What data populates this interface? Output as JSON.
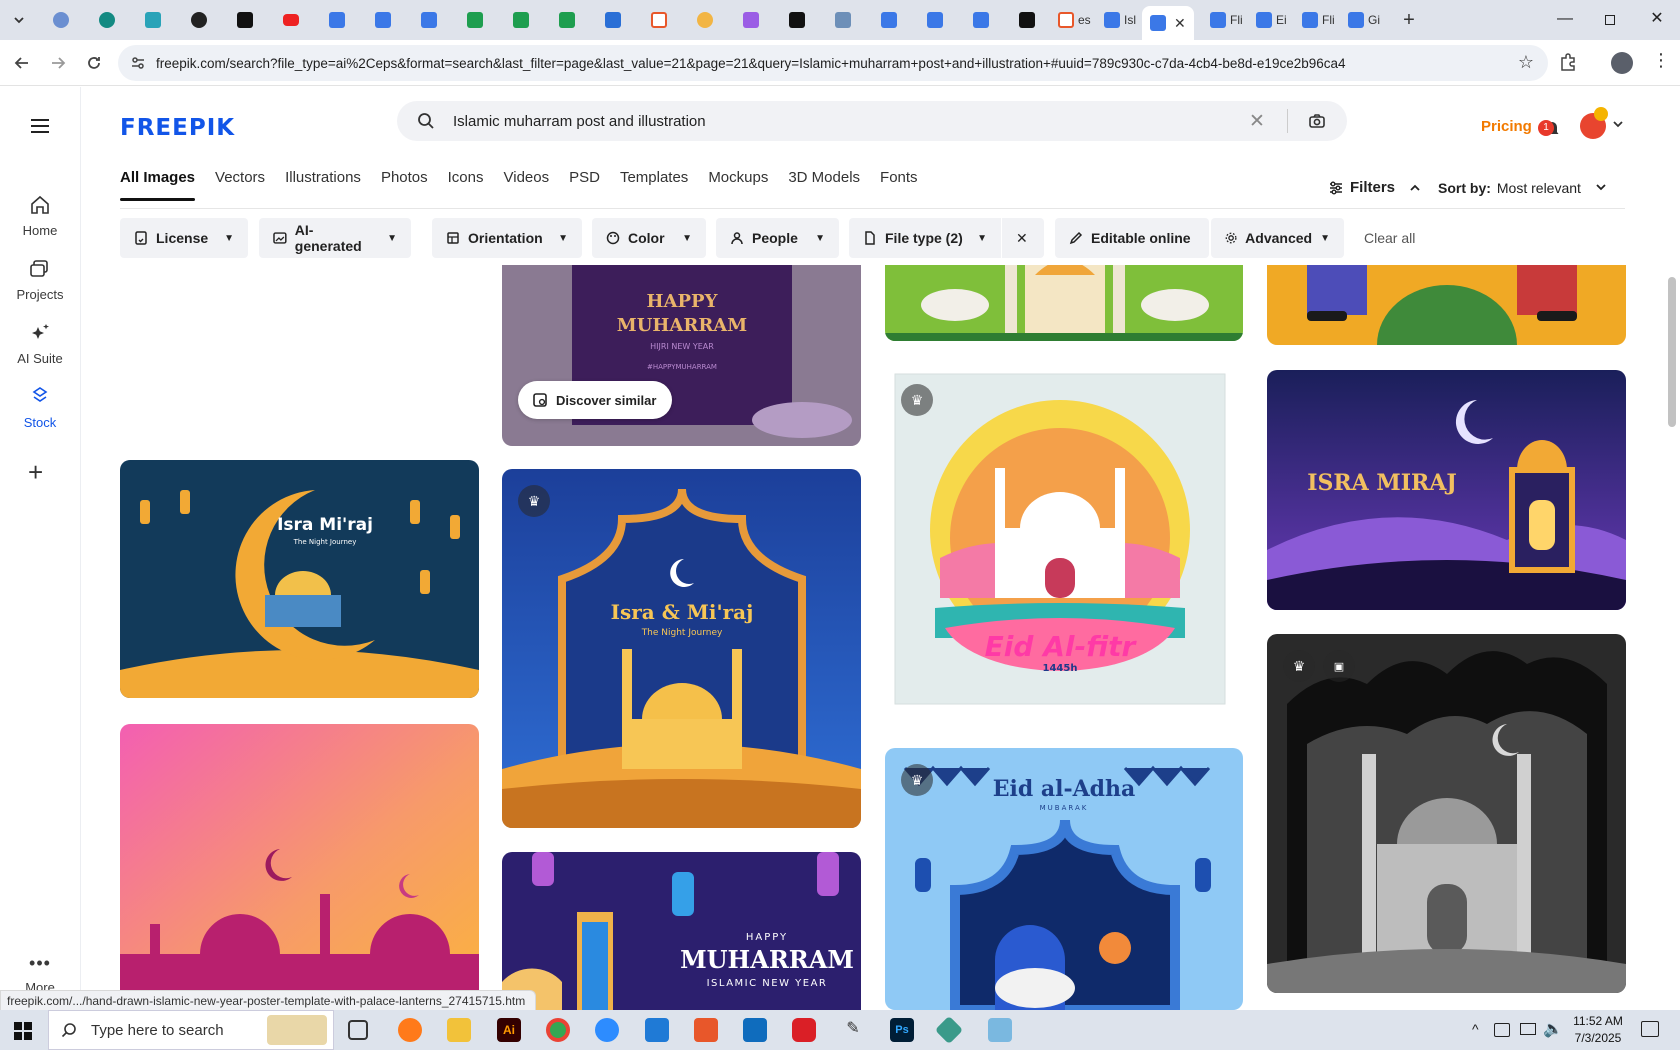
{
  "browser": {
    "tabs": [
      {
        "label": "es"
      },
      {
        "label": "Isl"
      },
      {
        "label": "Fli"
      },
      {
        "label": "Ei"
      },
      {
        "label": "Fli"
      },
      {
        "label": "Gi"
      }
    ],
    "url": "freepik.com/search?file_type=ai%2Ceps&format=search&last_filter=page&last_value=21&page=21&query=Islamic+muharram+post+and+illustration+#uuid=789c930c-c7da-4cb4-be8d-e19ce2b96ca4",
    "status_url": "freepik.com/.../hand-drawn-islamic-new-year-poster-template-with-palace-lanterns_27415715.htm"
  },
  "freepik": {
    "logo": "FREEPIK",
    "search_value": "Islamic muharram post and illustration",
    "pricing": "Pricing",
    "notification_count": "1",
    "sidebar": [
      {
        "label": "Home"
      },
      {
        "label": "Projects"
      },
      {
        "label": "AI Suite"
      },
      {
        "label": "Stock"
      },
      {
        "label": "More"
      }
    ],
    "type_tabs": [
      "All Images",
      "Vectors",
      "Illustrations",
      "Photos",
      "Icons",
      "Videos",
      "PSD",
      "Templates",
      "Mockups",
      "3D Models",
      "Fonts"
    ],
    "filters_label": "Filters",
    "sort_label": "Sort by:",
    "sort_value": "Most relevant",
    "chips": [
      "License",
      "AI-generated",
      "Orientation",
      "Color",
      "People",
      "File type (2)",
      "Editable online",
      "Advanced"
    ],
    "clear_all": "Clear all",
    "discover_similar": "Discover similar"
  },
  "cards": {
    "happy_muharram_top": {
      "line1": "HAPPY",
      "line2": "MUHARRAM",
      "line3": "HIJRI NEW YEAR",
      "line4": "#HAPPYMUHARRAM"
    },
    "isra_miraj_crescent": {
      "title": "Isra Mi'raj",
      "subtitle": "The Night Journey"
    },
    "isra_miraj_arch": {
      "title": "Isra & Mi'raj",
      "subtitle": "The Night Journey"
    },
    "muharram_lanterns": {
      "line1": "HAPPY",
      "line2": "MUHARRAM",
      "line3": "ISLAMIC NEW YEAR"
    },
    "eid_al_fitr": {
      "title": "Eid Al-fitr",
      "year": "1445h"
    },
    "eid_al_adha": {
      "title": "Eid al-Adha",
      "subtitle": "MUBARAK"
    },
    "isra_miraj_lantern": {
      "title": "ISRA MIRAJ"
    }
  },
  "taskbar": {
    "search_placeholder": "Type here to search",
    "time": "11:52 AM",
    "date": "7/3/2025"
  },
  "colors": {
    "brand": "#1255e8",
    "pricing": "#f27a00",
    "chip_bg": "#f1f2f5"
  }
}
